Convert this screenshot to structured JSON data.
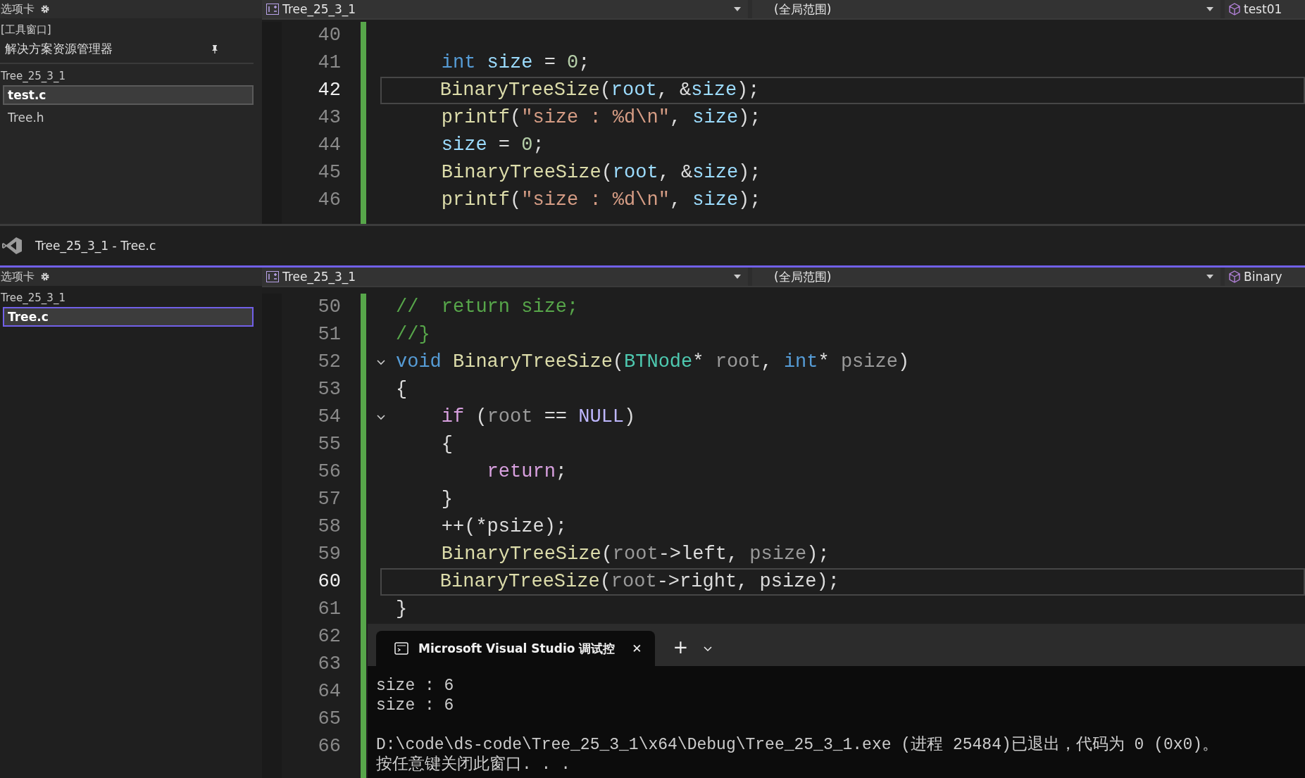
{
  "top_editor": {
    "sidebar": {
      "header": "选项卡",
      "section_label": "[工具窗口]",
      "panel_title": "解决方案资源管理器",
      "project": "Tree_25_3_1",
      "files": [
        {
          "text": "test.c",
          "selected": true
        },
        {
          "text": "Tree.h",
          "selected": false
        }
      ]
    },
    "nav": {
      "project": "Tree_25_3_1",
      "scope": "(全局范围)",
      "member": "test01"
    },
    "lines": [
      {
        "number": "40",
        "current": false,
        "fold": false
      },
      {
        "number": "41",
        "current": false,
        "fold": false,
        "tokens": [
          {
            "t": "    int",
            "color": "#569cd6"
          },
          {
            "t": " size",
            "color": "#9cdcfe"
          },
          {
            "t": " = ",
            "color": "#dcdcdc"
          },
          {
            "t": "0",
            "color": "#b5cea8"
          },
          {
            "t": ";",
            "color": "#dcdcdc"
          }
        ]
      },
      {
        "number": "42",
        "current": true,
        "fold": false,
        "tokens": [
          {
            "t": "    BinaryTreeSize",
            "color": "#dcdcaa"
          },
          {
            "t": "(",
            "color": "#dcdcdc"
          },
          {
            "t": "root",
            "color": "#9cdcfe"
          },
          {
            "t": ", &",
            "color": "#dcdcdc"
          },
          {
            "t": "size",
            "color": "#9cdcfe"
          },
          {
            "t": ");",
            "color": "#dcdcdc"
          }
        ]
      },
      {
        "number": "43",
        "current": false,
        "fold": false,
        "tokens": [
          {
            "t": "    printf",
            "color": "#dcdcaa"
          },
          {
            "t": "(",
            "color": "#dcdcdc"
          },
          {
            "t": "\"size : %d\\n\"",
            "color": "#d69d85"
          },
          {
            "t": ", ",
            "color": "#dcdcdc"
          },
          {
            "t": "size",
            "color": "#9cdcfe"
          },
          {
            "t": ");",
            "color": "#dcdcdc"
          }
        ]
      },
      {
        "number": "44",
        "current": false,
        "fold": false,
        "tokens": [
          {
            "t": "    size",
            "color": "#9cdcfe"
          },
          {
            "t": " = ",
            "color": "#dcdcdc"
          },
          {
            "t": "0",
            "color": "#b5cea8"
          },
          {
            "t": ";",
            "color": "#dcdcdc"
          }
        ]
      },
      {
        "number": "45",
        "current": false,
        "fold": false,
        "tokens": [
          {
            "t": "    BinaryTreeSize",
            "color": "#dcdcaa"
          },
          {
            "t": "(",
            "color": "#dcdcdc"
          },
          {
            "t": "root",
            "color": "#9cdcfe"
          },
          {
            "t": ", &",
            "color": "#dcdcdc"
          },
          {
            "t": "size",
            "color": "#9cdcfe"
          },
          {
            "t": ");",
            "color": "#dcdcdc"
          }
        ]
      },
      {
        "number": "46",
        "current": false,
        "fold": false,
        "tokens": [
          {
            "t": "    printf",
            "color": "#dcdcaa"
          },
          {
            "t": "(",
            "color": "#dcdcdc"
          },
          {
            "t": "\"size : %d\\n\"",
            "color": "#d69d85"
          },
          {
            "t": ", ",
            "color": "#dcdcdc"
          },
          {
            "t": "size",
            "color": "#9cdcfe"
          },
          {
            "t": ");",
            "color": "#dcdcdc"
          }
        ]
      }
    ]
  },
  "title_bar": {
    "title": "Tree_25_3_1 - Tree.c"
  },
  "bottom_editor": {
    "sidebar": {
      "header": "选项卡",
      "project": "Tree_25_3_1",
      "files": [
        {
          "text": "Tree.c",
          "selected": true
        }
      ]
    },
    "nav": {
      "project": "Tree_25_3_1",
      "scope": "(全局范围)",
      "member": "Binary"
    },
    "lines": [
      {
        "number": "50",
        "current": false,
        "fold": false,
        "tokens": [
          {
            "t": "//  return size;",
            "color": "#57a64a"
          }
        ]
      },
      {
        "number": "51",
        "current": false,
        "fold": false,
        "tokens": [
          {
            "t": "//}",
            "color": "#57a64a"
          }
        ]
      },
      {
        "number": "52",
        "current": false,
        "fold": true,
        "tokens": [
          {
            "t": "void",
            "color": "#569cd6"
          },
          {
            "t": " BinaryTreeSize",
            "color": "#dcdcaa"
          },
          {
            "t": "(",
            "color": "#dcdcdc"
          },
          {
            "t": "BTNode",
            "color": "#4ec9b0"
          },
          {
            "t": "* ",
            "color": "#dcdcdc"
          },
          {
            "t": "root",
            "color": "#9a9a9a"
          },
          {
            "t": ", ",
            "color": "#dcdcdc"
          },
          {
            "t": "int",
            "color": "#569cd6"
          },
          {
            "t": "* ",
            "color": "#dcdcdc"
          },
          {
            "t": "psize",
            "color": "#9a9a9a"
          },
          {
            "t": ")",
            "color": "#dcdcdc"
          }
        ]
      },
      {
        "number": "53",
        "current": false,
        "fold": false,
        "tokens": [
          {
            "t": "{",
            "color": "#dcdcdc"
          }
        ]
      },
      {
        "number": "54",
        "current": false,
        "fold": true,
        "tokens": [
          {
            "t": "    if",
            "color": "#d8a0df"
          },
          {
            "t": " (",
            "color": "#dcdcdc"
          },
          {
            "t": "root",
            "color": "#9a9a9a"
          },
          {
            "t": " == ",
            "color": "#dcdcdc"
          },
          {
            "t": "NULL",
            "color": "#beb7ff"
          },
          {
            "t": ")",
            "color": "#dcdcdc"
          }
        ]
      },
      {
        "number": "55",
        "current": false,
        "fold": false,
        "tokens": [
          {
            "t": "    {",
            "color": "#dcdcdc"
          }
        ]
      },
      {
        "number": "56",
        "current": false,
        "fold": false,
        "tokens": [
          {
            "t": "        return",
            "color": "#d8a0df"
          },
          {
            "t": ";",
            "color": "#dcdcdc"
          }
        ]
      },
      {
        "number": "57",
        "current": false,
        "fold": false,
        "tokens": [
          {
            "t": "    }",
            "color": "#dcdcdc"
          }
        ]
      },
      {
        "number": "58",
        "current": false,
        "fold": false,
        "tokens": [
          {
            "t": "    ++(*psize);",
            "color": "#dcdcdc"
          }
        ]
      },
      {
        "number": "59",
        "current": false,
        "fold": false,
        "tokens": [
          {
            "t": "    BinaryTreeSize",
            "color": "#dcdcaa"
          },
          {
            "t": "(",
            "color": "#dcdcdc"
          },
          {
            "t": "root",
            "color": "#9a9a9a"
          },
          {
            "t": "->left, ",
            "color": "#dcdcdc"
          },
          {
            "t": "psize",
            "color": "#9a9a9a"
          },
          {
            "t": ");",
            "color": "#dcdcdc"
          }
        ]
      },
      {
        "number": "60",
        "current": true,
        "fold": false,
        "tokens": [
          {
            "t": "    BinaryTreeSize",
            "color": "#dcdcaa"
          },
          {
            "t": "(",
            "color": "#dcdcdc"
          },
          {
            "t": "root",
            "color": "#9a9a9a"
          },
          {
            "t": "->right, psize);",
            "color": "#dcdcdc"
          }
        ]
      },
      {
        "number": "61",
        "current": false,
        "fold": false,
        "tokens": [
          {
            "t": "}",
            "color": "#dcdcdc"
          }
        ]
      },
      {
        "number": "62",
        "current": false
      },
      {
        "number": "63",
        "current": false
      },
      {
        "number": "64",
        "current": false
      },
      {
        "number": "65",
        "current": false
      },
      {
        "number": "66",
        "current": false
      }
    ],
    "terminal": {
      "tab": "Microsoft Visual Studio 调试控",
      "close": "✕",
      "new_tab": "+",
      "output": [
        [
          "size : 6",
          "size : 6"
        ],
        [
          "D:\\code\\ds-code\\Tree_25_3_1\\x64\\Debug\\Tree_25_3_1.exe (进程 25484)已退出，代码为 0 (0x0)。",
          "按任意键关闭此窗口. . ."
        ]
      ]
    }
  }
}
